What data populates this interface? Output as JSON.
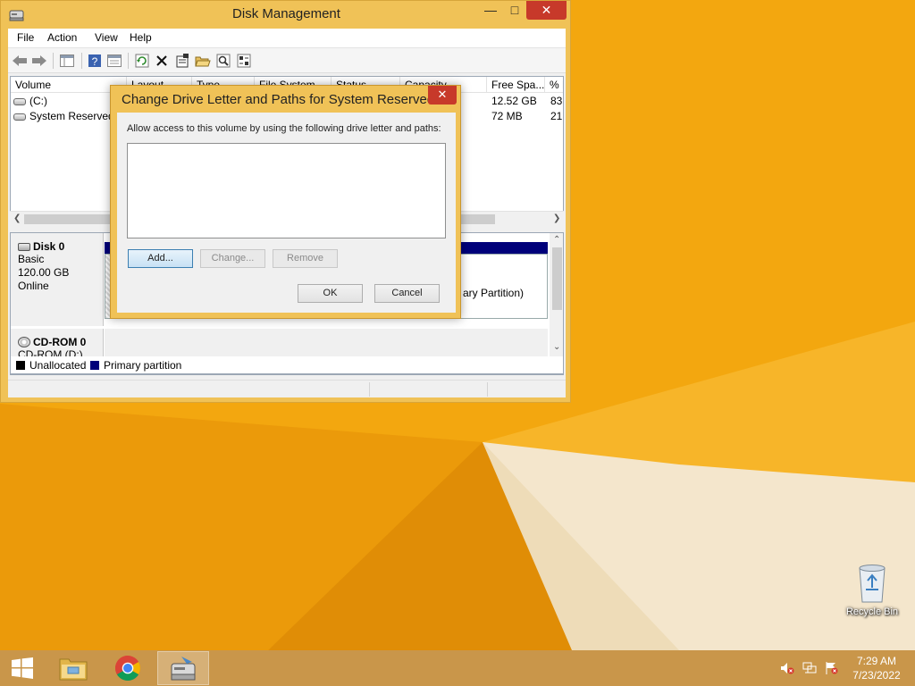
{
  "desktop": {
    "recycle_bin_label": "Recycle Bin"
  },
  "window": {
    "title": "Disk Management",
    "menu": [
      "File",
      "Action",
      "View",
      "Help"
    ],
    "volume_list": {
      "columns": [
        "Volume",
        "Layout",
        "Type",
        "File System",
        "Status",
        "Capacity",
        "Free Spa...",
        "% F"
      ],
      "rows": [
        {
          "volume": "(C:)",
          "free_space": "12.52 GB",
          "percent_free": "83"
        },
        {
          "volume": "System Reserved",
          "free_space": "72 MB",
          "percent_free": "21"
        }
      ]
    },
    "disks": [
      {
        "name": "Disk 0",
        "type": "Basic",
        "size": "120.00 GB",
        "status": "Online"
      },
      {
        "name": "CD-ROM 0",
        "type": "CD-ROM (D:)"
      }
    ],
    "partition_text": "ary Partition)",
    "legend": [
      {
        "label": "Unallocated",
        "color": "#000000"
      },
      {
        "label": "Primary partition",
        "color": "#00007a"
      }
    ]
  },
  "dialog": {
    "title": "Change Drive Letter and Paths for System Reserved",
    "prompt": "Allow access to this volume by using the following drive letter and paths:",
    "buttons": {
      "add": "Add...",
      "change": "Change...",
      "remove": "Remove",
      "ok": "OK",
      "cancel": "Cancel"
    }
  },
  "taskbar": {
    "time": "7:29 AM",
    "date": "7/23/2022"
  },
  "colors": {
    "accent": "#f0c257",
    "desktop_orange": "#f2a60d",
    "close_red": "#c7392a"
  }
}
